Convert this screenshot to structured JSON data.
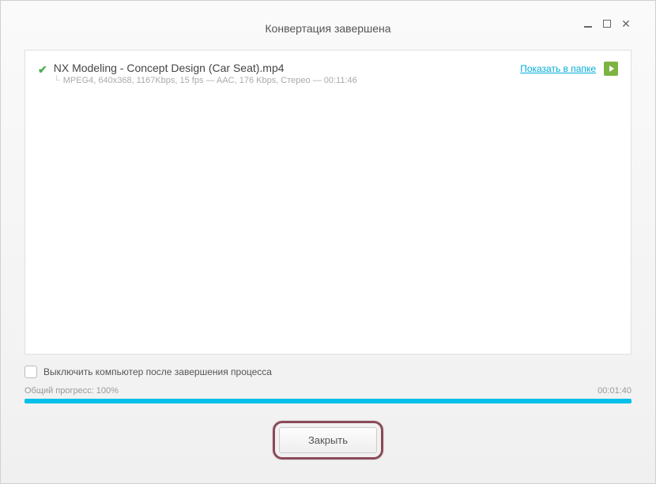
{
  "window": {
    "title": "Конвертация завершена"
  },
  "file": {
    "name": "NX Modeling - Concept Design (Car Seat).mp4",
    "meta": "MPEG4, 640x368, 1167Kbps, 15 fps — AAC, 176 Kbps, Стерео — 00:11:46",
    "show_in_folder": "Показать в папке"
  },
  "options": {
    "shutdown_label": "Выключить компьютер после завершения процесса"
  },
  "progress": {
    "label": "Общий прогресс: 100%",
    "time": "00:01:40"
  },
  "buttons": {
    "close": "Закрыть"
  }
}
